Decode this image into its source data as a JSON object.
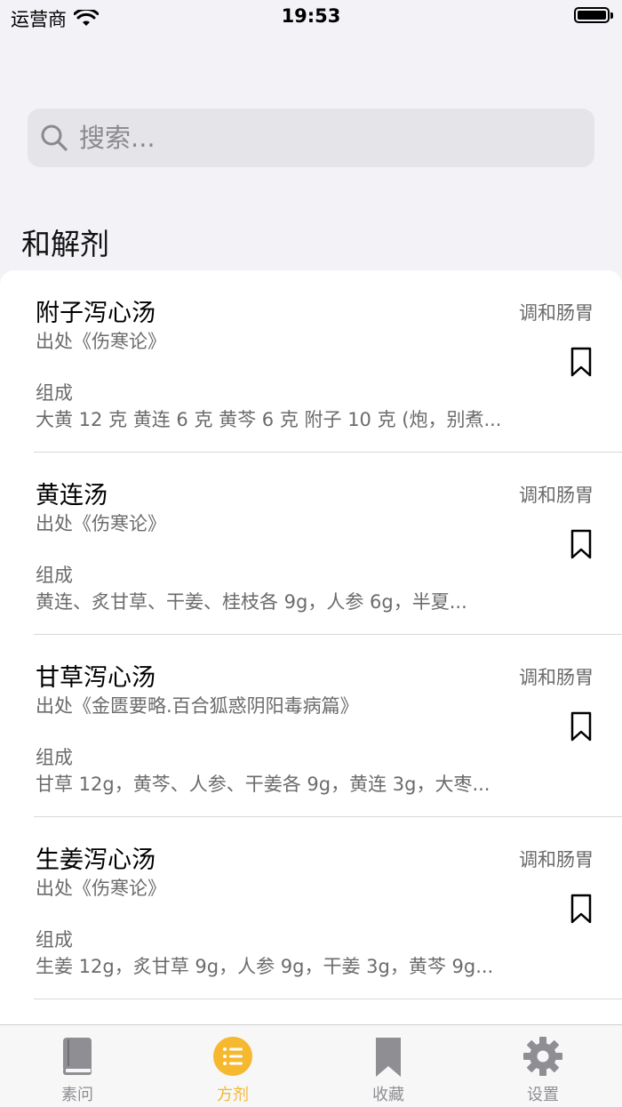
{
  "status_bar": {
    "carrier": "运营商",
    "time": "19:53"
  },
  "search": {
    "placeholder": "搜索..."
  },
  "section": {
    "title": "和解剂"
  },
  "formulas": [
    {
      "name": "附子泻心汤",
      "category": "调和肠胃",
      "source": "出处《伤寒论》",
      "composition_label": "组成",
      "composition": "大黄 12 克 黄连 6 克 黄芩 6 克 附子 10 克 (炮，别煮..."
    },
    {
      "name": "黄连汤",
      "category": "调和肠胃",
      "source": "出处《伤寒论》",
      "composition_label": "组成",
      "composition": "黄连、炙甘草、干姜、桂枝各 9g，人参 6g，半夏..."
    },
    {
      "name": "甘草泻心汤",
      "category": "调和肠胃",
      "source": "出处《金匮要略.百合狐惑阴阳毒病篇》",
      "composition_label": "组成",
      "composition": "甘草 12g，黄芩、人参、干姜各 9g，黄连 3g，大枣..."
    },
    {
      "name": "生姜泻心汤",
      "category": "调和肠胃",
      "source": "出处《伤寒论》",
      "composition_label": "组成",
      "composition": "生姜 12g，炙甘草 9g，人参 9g，干姜 3g，黄芩 9g..."
    }
  ],
  "tabs": [
    {
      "label": "素问",
      "icon": "book-icon",
      "active": false
    },
    {
      "label": "方剂",
      "icon": "list-icon",
      "active": true
    },
    {
      "label": "收藏",
      "icon": "bookmark-icon",
      "active": false
    },
    {
      "label": "设置",
      "icon": "gear-icon",
      "active": false
    }
  ],
  "colors": {
    "accent": "#f5b82e",
    "background": "#f2f2f7",
    "secondary_text": "#6b6b6b",
    "tab_inactive": "#8e8e93"
  }
}
